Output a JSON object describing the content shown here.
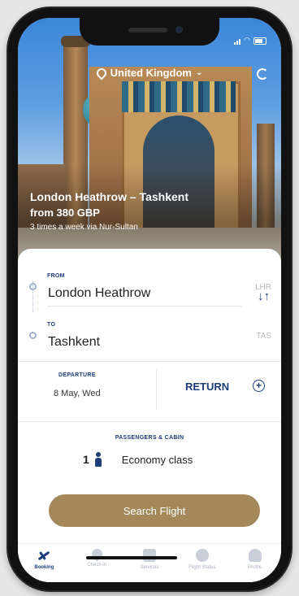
{
  "header": {
    "country": "United Kingdom"
  },
  "hero": {
    "route": "London Heathrow – Tashkent",
    "price": "from 380 GBP",
    "frequency": "3 times a week via Nur-Sultan"
  },
  "booking": {
    "from_label": "FROM",
    "from_city": "London Heathrow",
    "from_code": "LHR",
    "to_label": "TO",
    "to_city": "Tashkent",
    "to_code": "TAS",
    "departure_label": "DEPARTURE",
    "departure_value": "8 May, Wed",
    "return_label": "RETURN",
    "passengers_label": "PASSENGERS & CABIN",
    "passengers_count": "1",
    "cabin_class": "Economy class",
    "search_button": "Search Flight"
  },
  "tabbar": {
    "items": [
      {
        "label": "Booking",
        "icon": "plane-icon",
        "active": true
      },
      {
        "label": "Check-in",
        "icon": "checkin-icon",
        "active": false
      },
      {
        "label": "Services",
        "icon": "services-icon",
        "active": false
      },
      {
        "label": "Flight Status",
        "icon": "flight-status-icon",
        "active": false
      },
      {
        "label": "Profile",
        "icon": "profile-icon",
        "active": false
      }
    ]
  },
  "colors": {
    "accent": "#1c3d7a",
    "button": "#a3885a"
  }
}
